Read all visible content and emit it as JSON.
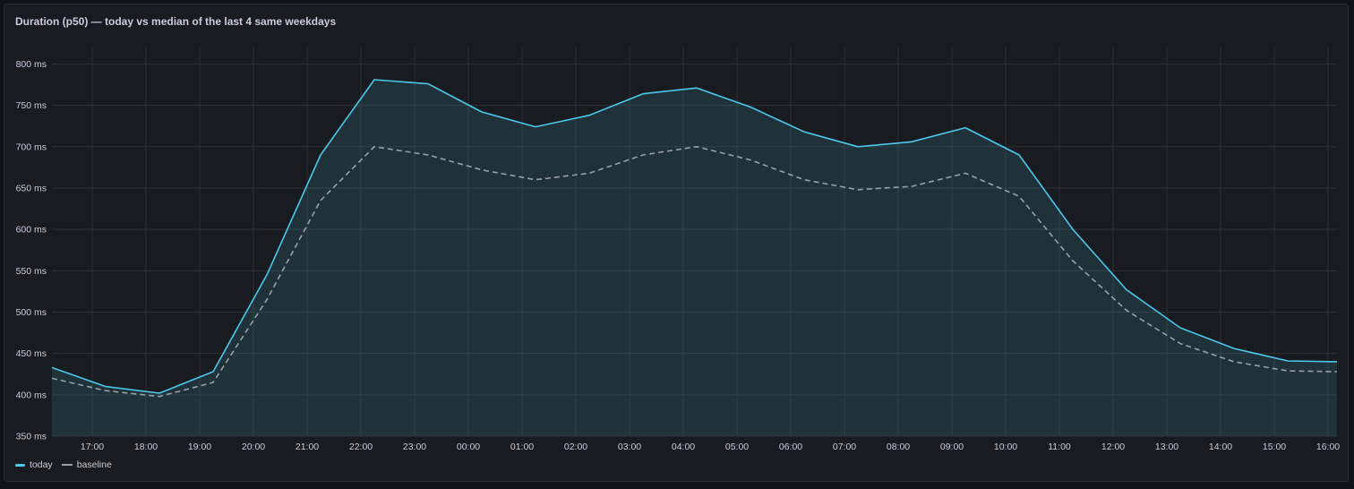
{
  "panel": {
    "title": "Duration (p50) — today vs median of the last 4 same weekdays"
  },
  "legend": {
    "today": "today",
    "baseline": "baseline"
  },
  "colors": {
    "today": "#4cc8ec",
    "baseline": "#9aa0a8",
    "grid": "#2c3035",
    "text": "#ccccdc"
  },
  "chart_data": {
    "type": "line",
    "title": "Duration (p50) — today vs median of the last 4 same weekdays",
    "x_ticks": [
      "17:00",
      "18:00",
      "19:00",
      "20:00",
      "21:00",
      "22:00",
      "23:00",
      "00:00",
      "01:00",
      "02:00",
      "03:00",
      "04:00",
      "05:00",
      "06:00",
      "07:00",
      "08:00",
      "09:00",
      "10:00",
      "11:00",
      "12:00",
      "13:00",
      "14:00",
      "15:00",
      "16:00"
    ],
    "y_ticks": [
      "350 ms",
      "400 ms",
      "450 ms",
      "500 ms",
      "550 ms",
      "600 ms",
      "650 ms",
      "700 ms",
      "750 ms",
      "800 ms"
    ],
    "xlim": [
      "16:15",
      "16:10"
    ],
    "ylim": [
      350,
      820
    ],
    "y_unit": "ms",
    "grid": true,
    "legend_position": "bottom-left",
    "series": [
      {
        "name": "today",
        "style": "solid-filled",
        "x": [
          "16:15",
          "17:15",
          "18:15",
          "19:15",
          "20:15",
          "21:15",
          "22:15",
          "23:15",
          "00:15",
          "01:15",
          "02:15",
          "03:15",
          "04:15",
          "05:15",
          "06:15",
          "07:15",
          "08:15",
          "09:15",
          "10:15",
          "11:15",
          "12:15",
          "13:15",
          "14:15",
          "15:15",
          "16:10"
        ],
        "values": [
          433,
          410,
          402,
          428,
          545,
          690,
          781,
          776,
          742,
          724,
          738,
          764,
          771,
          748,
          718,
          700,
          706,
          723,
          690,
          600,
          527,
          481,
          456,
          441,
          440
        ]
      },
      {
        "name": "baseline",
        "style": "dashed",
        "x": [
          "16:15",
          "17:15",
          "18:15",
          "19:15",
          "20:15",
          "21:15",
          "22:15",
          "23:15",
          "00:15",
          "01:15",
          "02:15",
          "03:15",
          "04:15",
          "05:15",
          "06:15",
          "07:15",
          "08:15",
          "09:15",
          "10:15",
          "11:15",
          "12:15",
          "13:15",
          "14:15",
          "15:15",
          "16:10"
        ],
        "values": [
          420,
          405,
          398,
          415,
          515,
          635,
          700,
          690,
          672,
          660,
          668,
          690,
          700,
          684,
          660,
          648,
          652,
          668,
          640,
          562,
          502,
          462,
          440,
          429,
          428
        ]
      }
    ]
  }
}
